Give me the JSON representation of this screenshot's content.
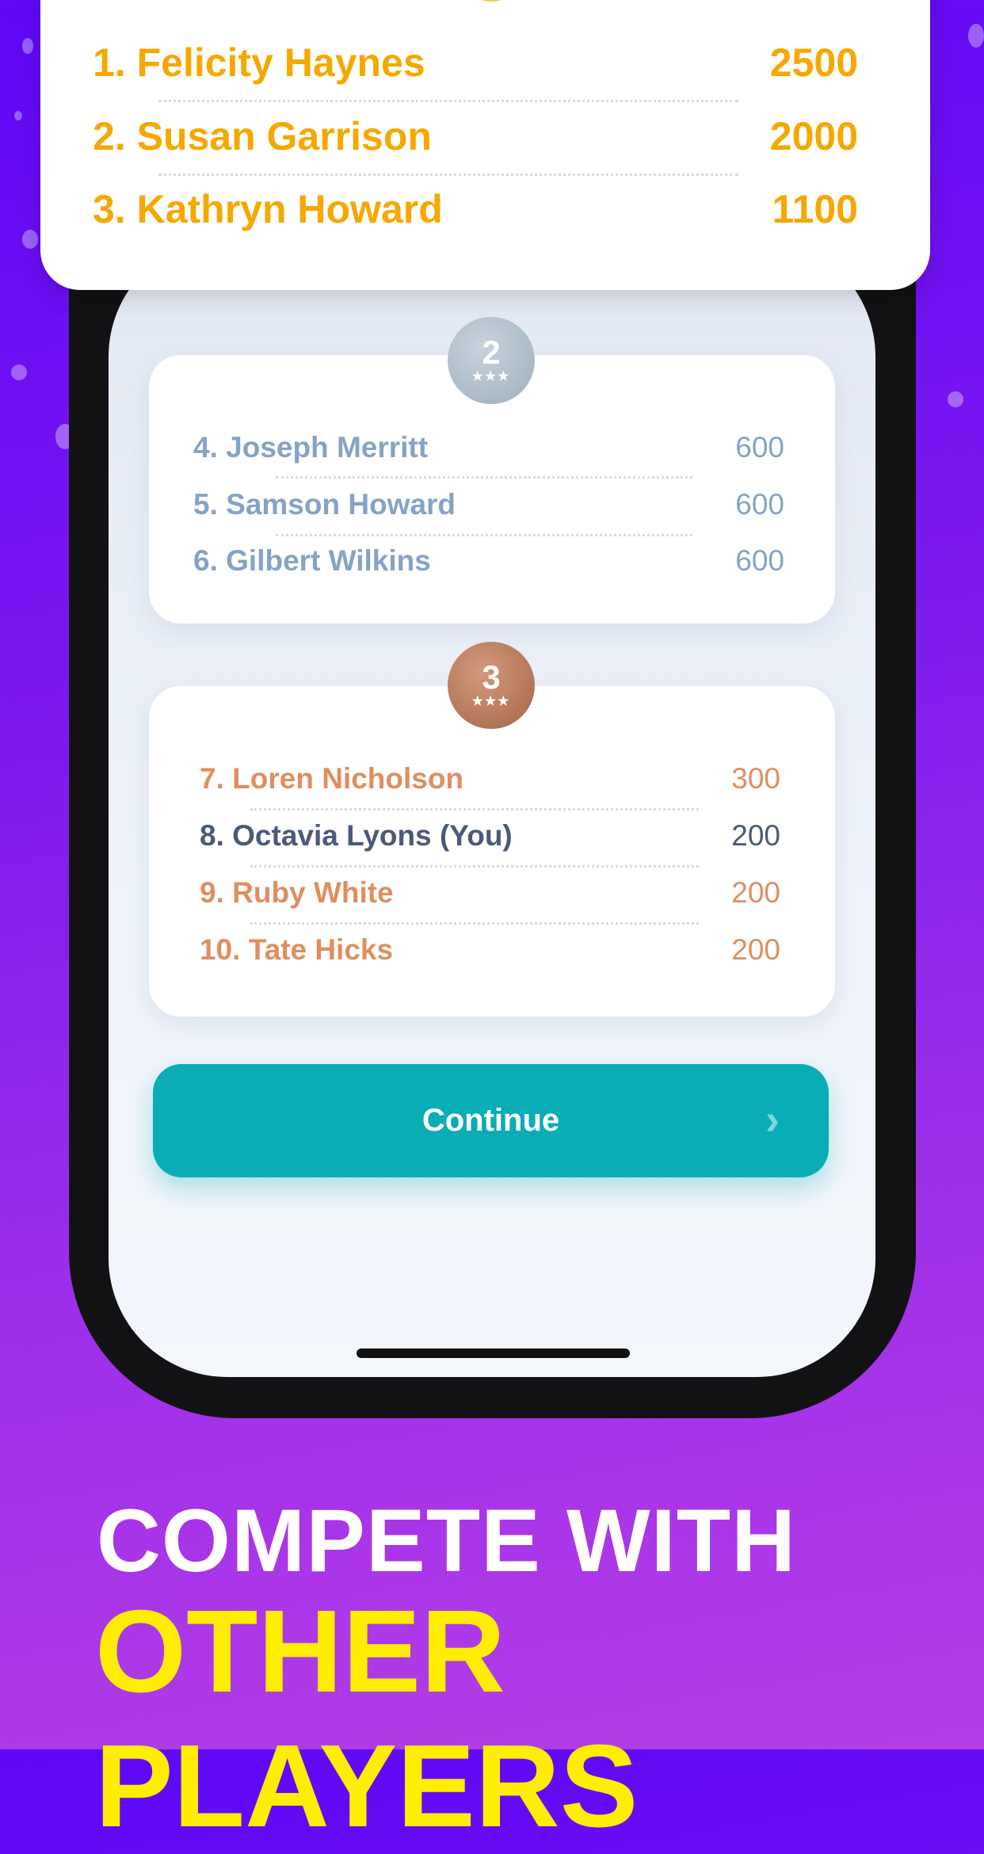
{
  "top_list": [
    {
      "label": "1.  Felicity Haynes",
      "score": "2500"
    },
    {
      "label": "2. Susan Garrison",
      "score": "2000"
    },
    {
      "label": "3. Kathryn Howard",
      "score": "1100"
    }
  ],
  "silver": {
    "medal": "2",
    "stars": "★★★",
    "rows": [
      {
        "label": "4. Joseph Merritt",
        "score": "600"
      },
      {
        "label": "5. Samson Howard",
        "score": "600"
      },
      {
        "label": "6. Gilbert Wilkins",
        "score": "600"
      }
    ]
  },
  "bronze": {
    "medal": "3",
    "stars": "★★★",
    "rows": [
      {
        "label": "7. Loren Nicholson",
        "score": "300"
      },
      {
        "label": "8. Octavia Lyons (You)",
        "score": "200"
      },
      {
        "label": "9. Ruby White",
        "score": "200"
      },
      {
        "label": "10. Tate Hicks",
        "score": "200"
      }
    ]
  },
  "continue_label": "Continue",
  "headline": {
    "line1": "COMPETE WITH",
    "line2": "OTHER PLAYERS"
  },
  "colors": {
    "gold": "#f5a800",
    "silver": "#86a3c6",
    "bronze": "#de8f60",
    "you": "#4a5a78",
    "button": "#0aacb6",
    "headline": "#ffee00"
  }
}
